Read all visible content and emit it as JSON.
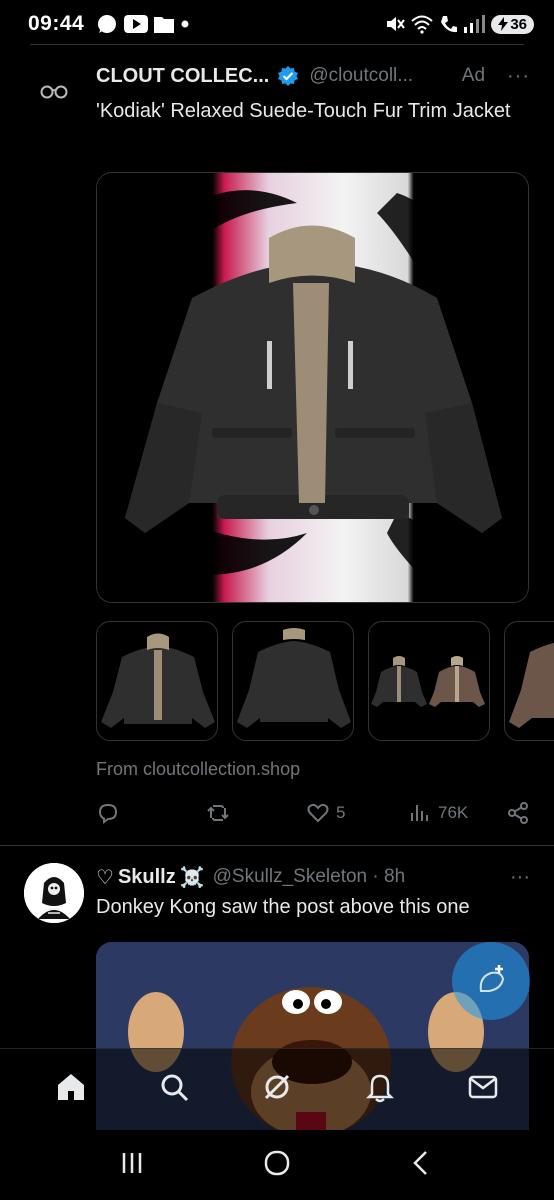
{
  "status_bar": {
    "time": "09:44",
    "battery": "36",
    "left_icons": [
      "whatsapp-icon",
      "youtube-icon",
      "folder-icon",
      "dot-icon"
    ],
    "right_icons": [
      "mute-icon",
      "wifi-icon",
      "call-icon",
      "signal-icon",
      "battery-icon"
    ]
  },
  "tweet_ad": {
    "name": "CLOUT COLLEC...",
    "handle": "@cloutcoll...",
    "ad_label": "Ad",
    "more": "···",
    "text": "'Kodiak' Relaxed Suede-Touch Fur Trim Jacket",
    "from_text": "From cloutcollection.shop",
    "actions": {
      "reply_count": "",
      "retweet_count": "",
      "like_count": "5",
      "views_count": "76K"
    },
    "colors": {
      "jacket": "#2f2f2f",
      "fur": "#a8977f",
      "jacket_brown": "#6b5649"
    }
  },
  "tweet_2": {
    "name_prefix": "♡",
    "name": "Skullz",
    "name_emoji": "☠️",
    "handle": "@Skullz_Skeleton · 8h",
    "more": "···",
    "text": "Donkey Kong saw the post above this one"
  },
  "bottom_nav": {
    "items": [
      "home-icon",
      "search-icon",
      "grok-icon",
      "notifications-icon",
      "messages-icon"
    ]
  },
  "system_nav": {
    "items": [
      "recents-icon",
      "home-circle-icon",
      "back-icon"
    ]
  },
  "accent_color": "#1d9bf0"
}
